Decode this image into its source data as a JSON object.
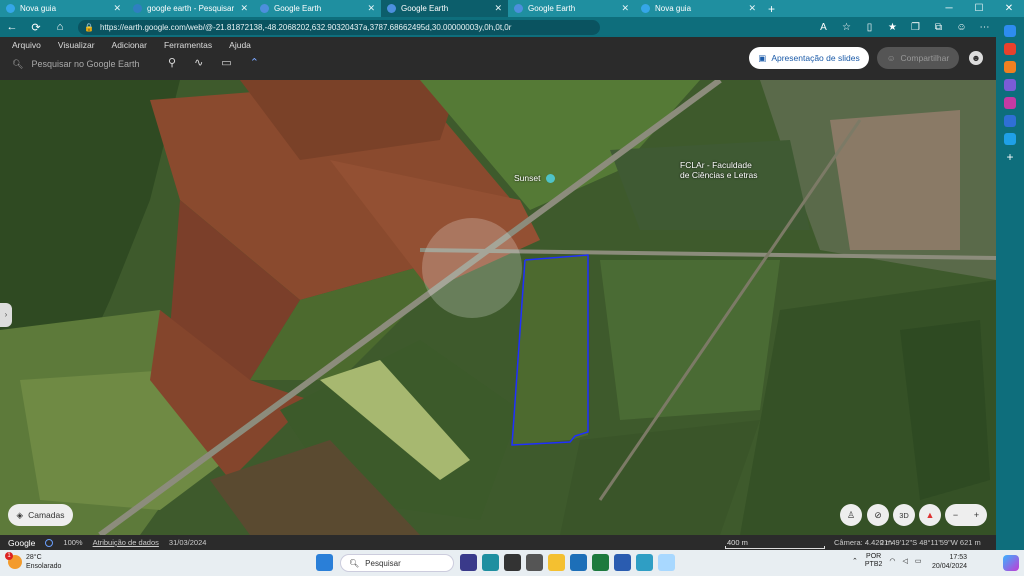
{
  "browser": {
    "tabs": [
      {
        "title": "Nova guia",
        "active": false,
        "icon": "edge-icon",
        "color": "#35a6e8"
      },
      {
        "title": "google earth - Pesquisar",
        "active": false,
        "icon": "bing-icon",
        "color": "#2f7fc1"
      },
      {
        "title": "Google Earth",
        "active": false,
        "icon": "google-earth-icon",
        "color": "#4c8fdd"
      },
      {
        "title": "Google Earth",
        "active": true,
        "icon": "google-earth-icon",
        "color": "#4c8fdd"
      },
      {
        "title": "Google Earth",
        "active": false,
        "icon": "google-earth-icon",
        "color": "#4c8fdd"
      },
      {
        "title": "Nova guia",
        "active": false,
        "icon": "edge-icon",
        "color": "#35a6e8"
      }
    ],
    "new_tab": "+",
    "url": "https://earth.google.com/web/@-21.81872138,-48.2068202,632.90320437a,3787.68662495d,30.00000003y,0h,0t,0r"
  },
  "earth": {
    "menu": [
      "Arquivo",
      "Visualizar",
      "Adicionar",
      "Ferramentas",
      "Ajuda"
    ],
    "search_placeholder": "Pesquisar no Google Earth",
    "slides_button": "Apresentação de slides",
    "share_button": "Compartilhar",
    "layers_button": "Camadas",
    "map_labels": {
      "sunset": "Sunset",
      "faculty_line1": "FCLAr - Faculdade",
      "faculty_line2": "de Ciências e Letras"
    },
    "map_controls": {
      "view3d": "3D",
      "zoom_out": "−",
      "zoom_in": "+"
    },
    "status": {
      "brand": "Google",
      "loaded": "100%",
      "attribution": "Atribuição de dados",
      "date": "31/03/2024",
      "scale": "400 m",
      "camera": "Câmera: 4.420 m",
      "coords": "21°49'12\"S 48°11'59\"W  621 m"
    }
  },
  "taskbar": {
    "weather_temp": "28°C",
    "weather_desc": "Ensolarado",
    "weather_badge": "1",
    "search": "Pesquisar",
    "lang1": "POR",
    "lang2": "PTB2",
    "time": "17:53",
    "date": "20/04/2024"
  },
  "colors": {
    "browser_frame": "#0e6e7c",
    "active_tab": "#0c5e6b",
    "earth_toolbar": "#2b2b2b",
    "parcel_outline": "#1f2fff"
  }
}
